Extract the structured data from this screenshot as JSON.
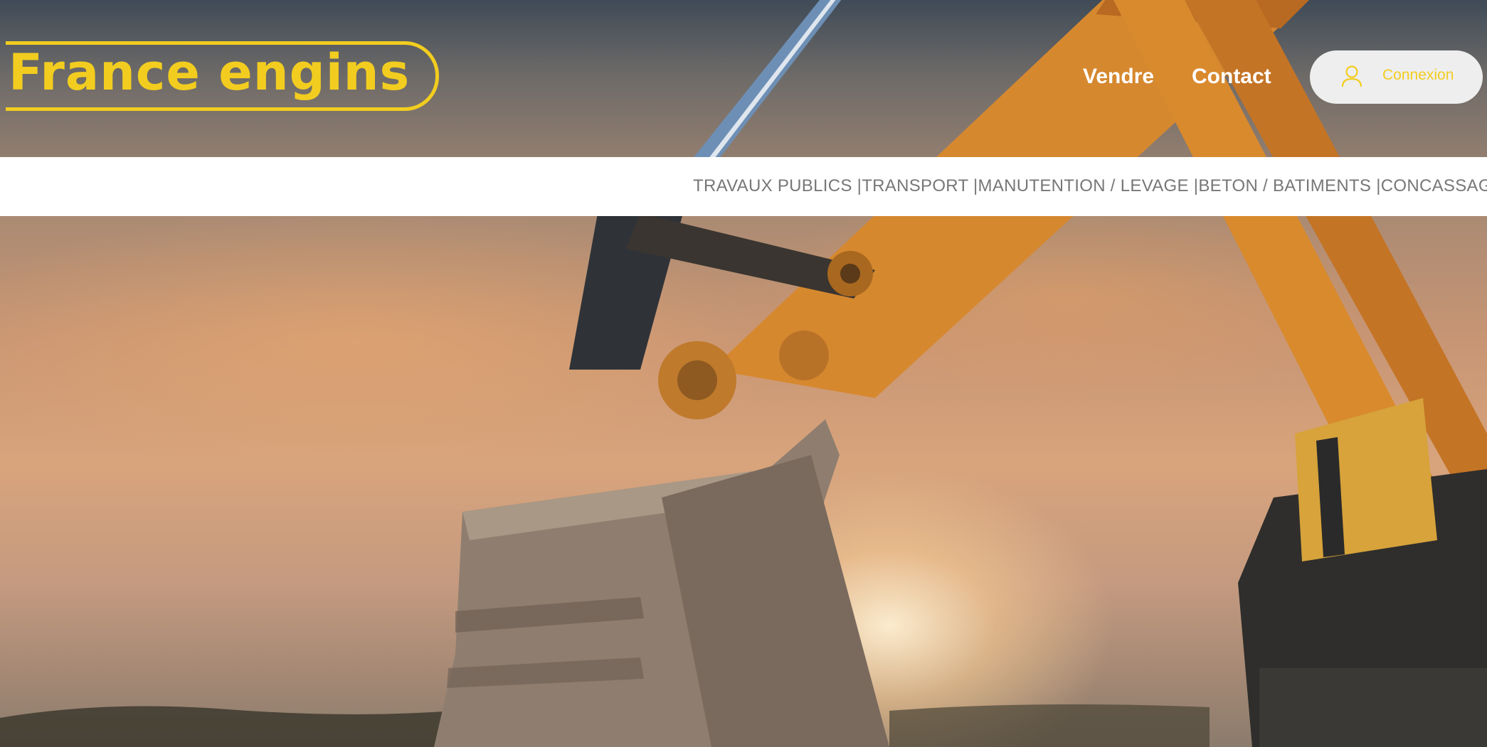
{
  "header": {
    "logo_text": "France engins",
    "nav": {
      "vendre_label": "Vendre",
      "contact_label": "Contact"
    },
    "login": {
      "label": "Connexion",
      "icon": "user-icon"
    }
  },
  "categories": {
    "items": [
      "TRAVAUX PUBLICS ",
      "TRANSPORT ",
      "MANUTENTION / LEVAGE ",
      "BETON / BATIMENTS ",
      "CONCASSAGE / FORAGE"
    ],
    "separator": "|"
  },
  "colors": {
    "brand_yellow": "#f2cd1f",
    "strip_background": "#ffffff",
    "category_text": "#777777",
    "login_background": "#eeeeee"
  },
  "hero": {
    "image": "excavator-bucket-at-sunset"
  }
}
